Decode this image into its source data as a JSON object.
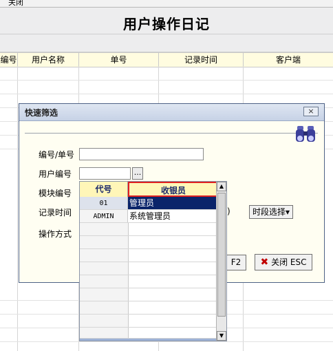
{
  "toolbar": {
    "close_label": "关闭"
  },
  "page": {
    "title": "用户操作日记"
  },
  "grid": {
    "columns": [
      "编号",
      "用户名称",
      "单号",
      "记录时间",
      "客户端"
    ]
  },
  "dialog": {
    "title": "快速筛选",
    "close_icon": "×",
    "fields": {
      "code_label": "编号/单号",
      "user_label": "用户编号",
      "module_label": "模块编号",
      "time_label": "记录时间",
      "method_label": "操作方式"
    },
    "ellipsis": "...",
    "time_button": "时段选择▾",
    "paren": ")",
    "f2_button": "F2",
    "close_button": "关闭 ESC"
  },
  "dropdown": {
    "headers": [
      "代号",
      "收银员"
    ],
    "rows": [
      {
        "code": "01",
        "name": "管理员",
        "selected": true
      },
      {
        "code": "ADMIN",
        "name": "系统管理员",
        "selected": false
      }
    ],
    "scroll_up": "▲",
    "scroll_down": "▼"
  },
  "colors": {
    "selection": "#0a246a",
    "header_bg": "#fff6b8",
    "highlight_border": "#e02020"
  }
}
